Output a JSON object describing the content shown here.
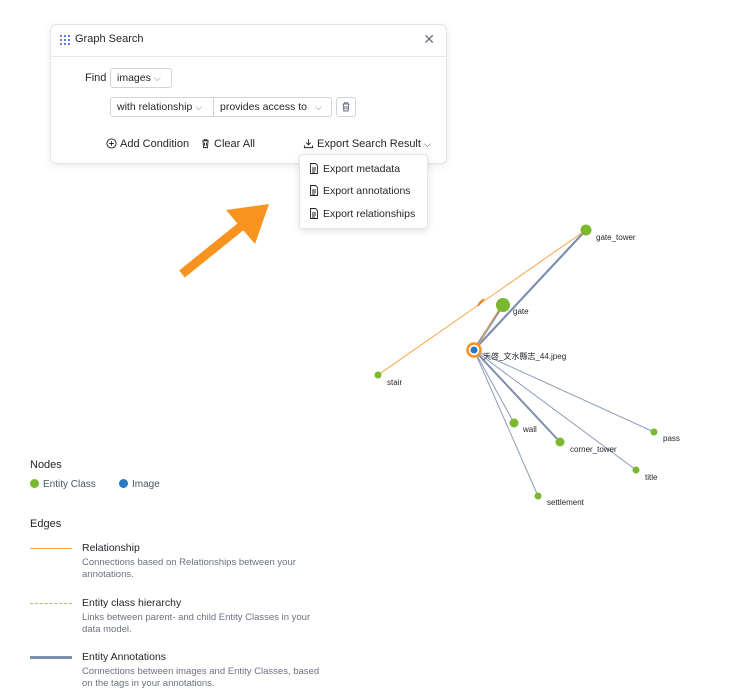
{
  "search_panel": {
    "title": "Graph Search",
    "find_label": "Find",
    "find_value": "images",
    "relation_type": "with relationship",
    "relation_value": "provides access to",
    "add_condition": "Add Condition",
    "clear_all": "Clear All",
    "export": "Export Search Result"
  },
  "export_menu": {
    "items": [
      "Export metadata",
      "Export annotations",
      "Export relationships"
    ]
  },
  "graph": {
    "image_node": "天啓_文水縣志_44.jpeg",
    "entity_nodes": [
      "gate_tower",
      "gate",
      "stair",
      "wall",
      "corner_tower",
      "pass",
      "title",
      "settlement"
    ]
  },
  "legend": {
    "nodes_heading": "Nodes",
    "entity_class": "Entity Class",
    "image": "Image",
    "edges_heading": "Edges",
    "edges": [
      {
        "title": "Relationship",
        "desc": "Connections based on Relationships between your annotations."
      },
      {
        "title": "Entity class hierarchy",
        "desc": "Links between parent- and child Entity Classes in your data model."
      },
      {
        "title": "Entity Annotations",
        "desc": "Connections between images and Entity Classes, based on the tags in your annotations."
      }
    ]
  },
  "colors": {
    "entity_class": "#7cb82f",
    "image": "#2a78c2",
    "relationship": "#f5a547",
    "annotation_edge": "#8c9bb6",
    "arrow": "#f7931e"
  }
}
